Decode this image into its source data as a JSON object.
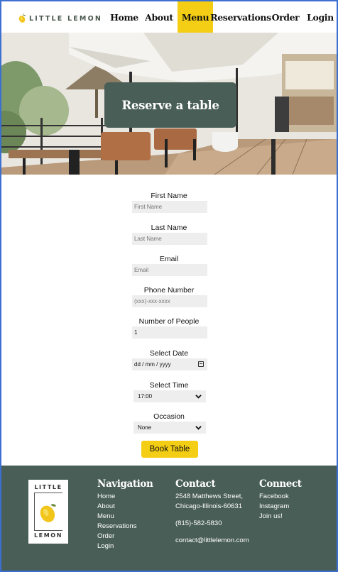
{
  "brand": {
    "logo_text": "LITTLE LEMON"
  },
  "nav": {
    "items": [
      {
        "label": "Home"
      },
      {
        "label": "About"
      },
      {
        "label": "Menu",
        "active": true
      },
      {
        "label": "Reservations"
      },
      {
        "label": "Order"
      },
      {
        "label": "Login"
      }
    ]
  },
  "hero": {
    "title": "Reserve a table"
  },
  "form": {
    "first_name": {
      "label": "First Name",
      "placeholder": "First Name"
    },
    "last_name": {
      "label": "Last Name",
      "placeholder": "Last Name"
    },
    "email": {
      "label": "Email",
      "placeholder": "Email"
    },
    "phone": {
      "label": "Phone Number",
      "placeholder": "(xxx)-xxx-xxxx"
    },
    "people": {
      "label": "Number of People",
      "value": "1"
    },
    "date": {
      "label": "Select Date",
      "placeholder": "dd / mm / yyyy"
    },
    "time": {
      "label": "Select Time",
      "value": "17:00"
    },
    "occasion": {
      "label": "Occasion",
      "value": "None"
    },
    "submit_label": "Book Table"
  },
  "footer": {
    "logo_top": "LITTLE",
    "logo_bottom": "LEMON",
    "navigation": {
      "title": "Navigation",
      "links": [
        "Home",
        "About",
        "Menu",
        "Reservations",
        "Order",
        "Login"
      ]
    },
    "contact": {
      "title": "Contact",
      "address_line1": "2548 Matthews Street,",
      "address_line2": "Chicago-Illinois-60631",
      "phone": "(815)-582-5830",
      "email": "contact@littlelemon.com"
    },
    "connect": {
      "title": "Connect",
      "links": [
        "Facebook",
        "Instagram",
        "Join us!"
      ]
    }
  },
  "colors": {
    "accent": "#f4ce14",
    "primary": "#495e57",
    "frame": "#3b6fd1"
  }
}
